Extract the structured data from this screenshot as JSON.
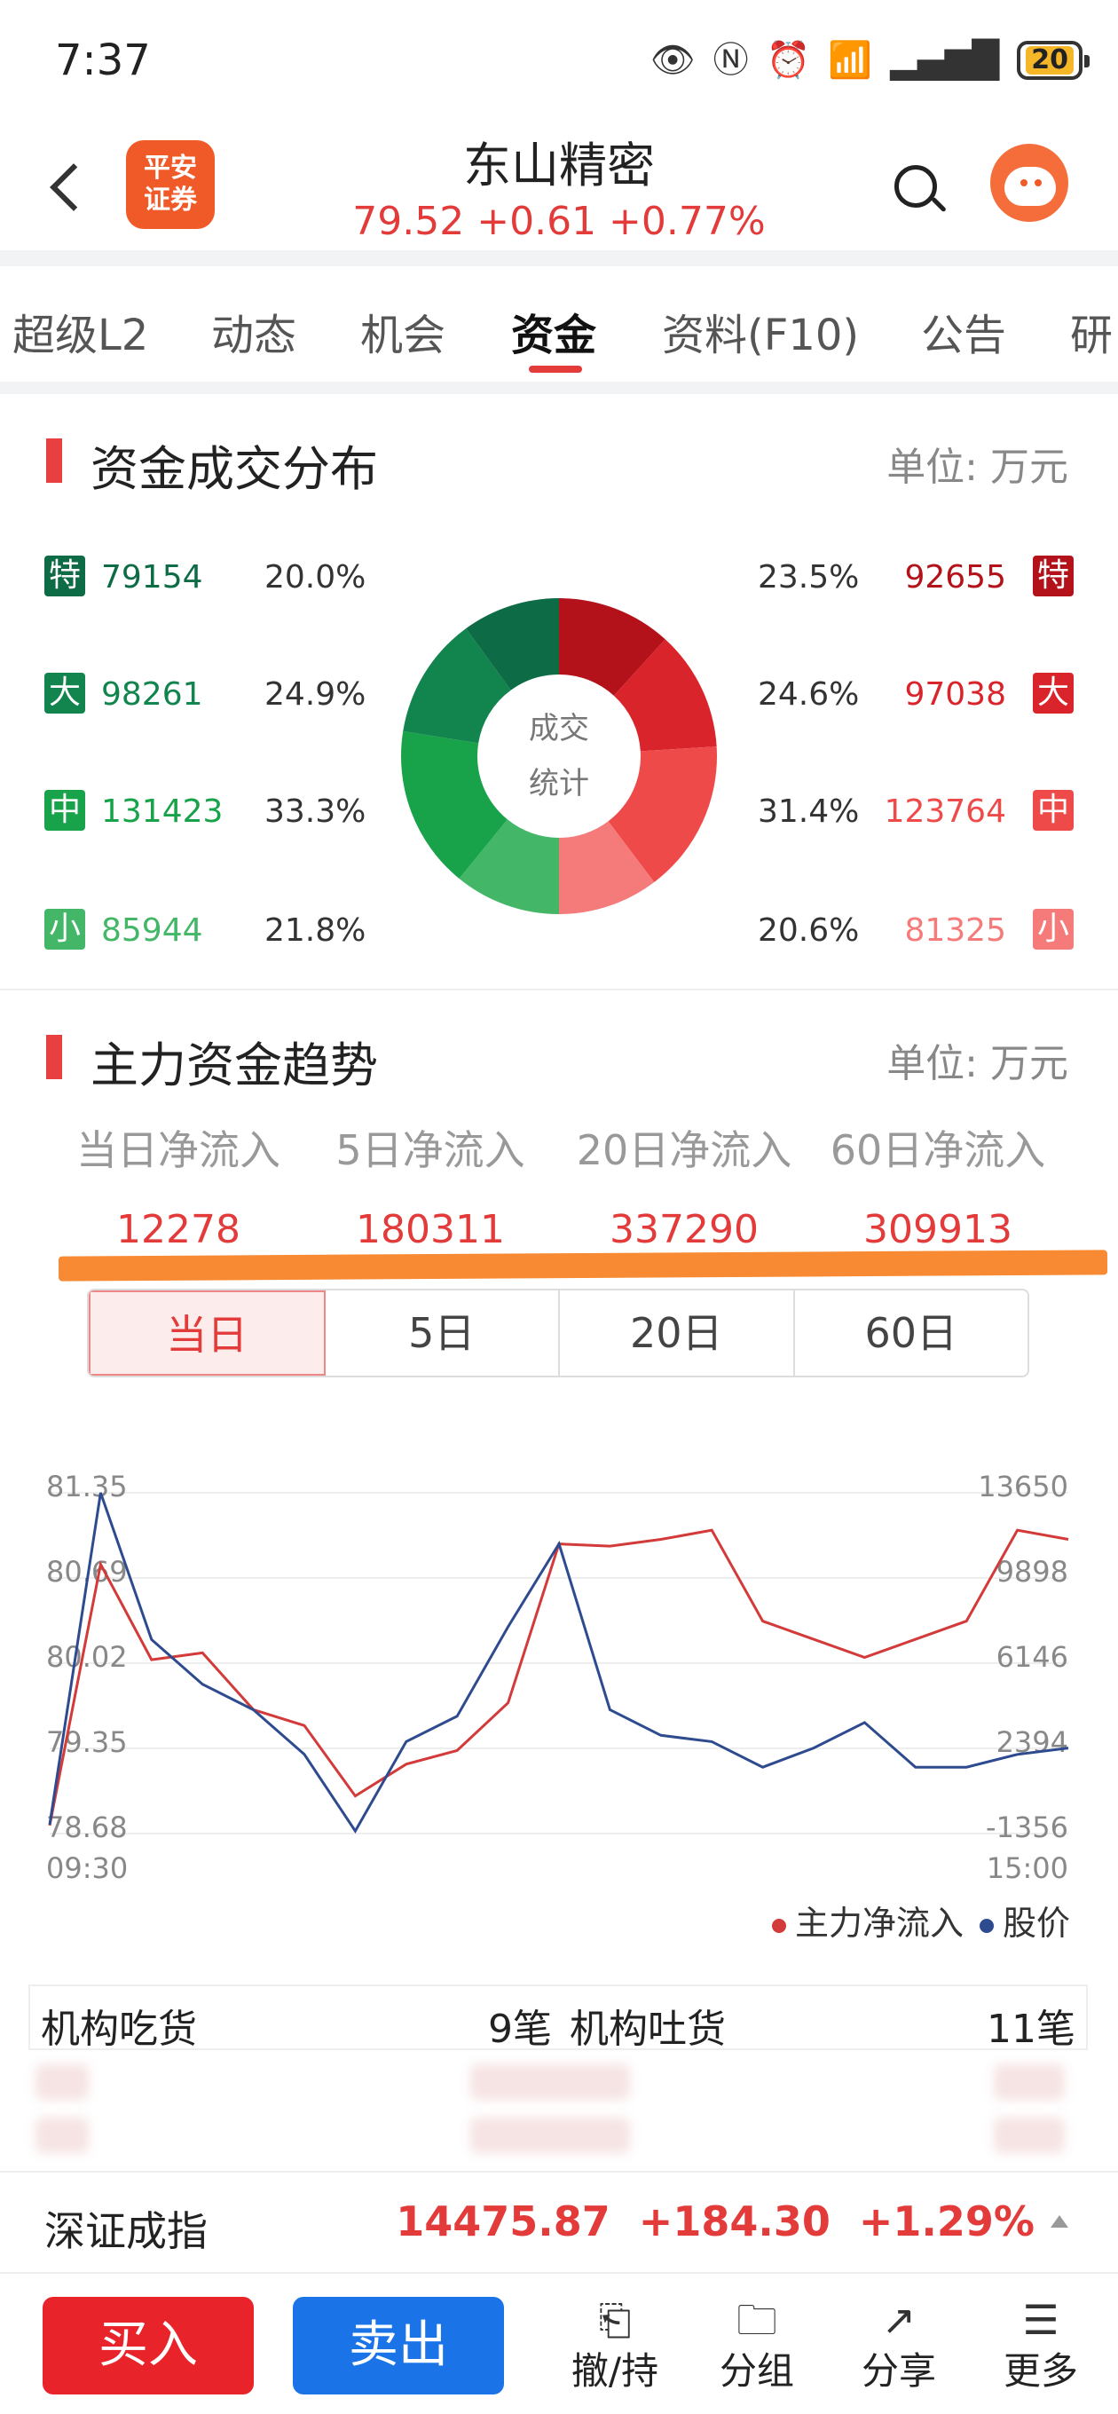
{
  "status": {
    "time": "7:37",
    "battery": "20"
  },
  "header": {
    "broker_logo_text": "平安证券",
    "stock_name": "东山精密",
    "quote": "79.52 +0.61 +0.77%"
  },
  "tabs": [
    "超级L2",
    "动态",
    "机会",
    "资金",
    "资料(F10)",
    "公告",
    "研"
  ],
  "active_tab": "资金",
  "distribution": {
    "title": "资金成交分布",
    "unit": "单位: 万元",
    "center_line1": "成交",
    "center_line2": "统计",
    "left": [
      {
        "tag": "特",
        "value": "79154",
        "pct": "20.0%",
        "color": "#0d6b45"
      },
      {
        "tag": "大",
        "value": "98261",
        "pct": "24.9%",
        "color": "#12844d"
      },
      {
        "tag": "中",
        "value": "131423",
        "pct": "33.3%",
        "color": "#18a34a"
      },
      {
        "tag": "小",
        "value": "85944",
        "pct": "21.8%",
        "color": "#43b767"
      }
    ],
    "right": [
      {
        "tag": "特",
        "value": "92655",
        "pct": "23.5%",
        "color": "#b3121a"
      },
      {
        "tag": "大",
        "value": "97038",
        "pct": "24.6%",
        "color": "#d8242a"
      },
      {
        "tag": "中",
        "value": "123764",
        "pct": "31.4%",
        "color": "#ef4a4a"
      },
      {
        "tag": "小",
        "value": "81325",
        "pct": "20.6%",
        "color": "#f57a7a"
      }
    ]
  },
  "trend": {
    "title": "主力资金趋势",
    "unit": "单位: 万元",
    "flows": [
      {
        "label": "当日净流入",
        "value": "12278"
      },
      {
        "label": "5日净流入",
        "value": "180311"
      },
      {
        "label": "20日净流入",
        "value": "337290"
      },
      {
        "label": "60日净流入",
        "value": "309913"
      }
    ],
    "periods": [
      "当日",
      "5日",
      "20日",
      "60日"
    ],
    "active_period": "当日"
  },
  "chart_data": {
    "type": "line",
    "x_start": "09:30",
    "x_end": "15:00",
    "left_ticks": [
      "81.35",
      "80.69",
      "80.02",
      "79.35",
      "78.68"
    ],
    "right_ticks": [
      "13650",
      "9898",
      "6146",
      "2394",
      "-1356"
    ],
    "legend": [
      "主力净流入",
      "股价"
    ],
    "colors": {
      "flow": "#d33a3a",
      "price": "#2e4b8f"
    },
    "x": [
      0,
      0.05,
      0.1,
      0.15,
      0.2,
      0.25,
      0.3,
      0.35,
      0.4,
      0.45,
      0.5,
      0.55,
      0.6,
      0.65,
      0.7,
      0.75,
      0.8,
      0.85,
      0.9,
      0.95,
      1.0
    ],
    "series": [
      {
        "name": "股价",
        "values": [
          78.75,
          81.35,
          80.2,
          79.85,
          79.65,
          79.3,
          78.7,
          79.4,
          79.6,
          80.3,
          80.95,
          79.65,
          79.45,
          79.4,
          79.2,
          79.35,
          79.55,
          79.2,
          79.2,
          79.3,
          79.35
        ]
      },
      {
        "name": "主力净流入",
        "values": [
          -1000,
          10500,
          6300,
          6600,
          4100,
          3400,
          300,
          1700,
          2300,
          4400,
          11400,
          11300,
          11600,
          12000,
          8000,
          7200,
          6400,
          7200,
          8000,
          12000,
          11600
        ]
      }
    ]
  },
  "institution": {
    "buy_label": "机构吃货",
    "buy_count": "9笔",
    "sell_label": "机构吐货",
    "sell_count": "11笔"
  },
  "index": {
    "name": "深证成指",
    "value": "14475.87",
    "change": "+184.30",
    "pct": "+1.29%"
  },
  "bottom": {
    "buy": "买入",
    "sell": "卖出",
    "tools": [
      {
        "icon": "withdraw-icon",
        "label": "撤/持"
      },
      {
        "icon": "folder-icon",
        "label": "分组"
      },
      {
        "icon": "share-icon",
        "label": "分享"
      },
      {
        "icon": "more-icon",
        "label": "更多"
      }
    ]
  }
}
